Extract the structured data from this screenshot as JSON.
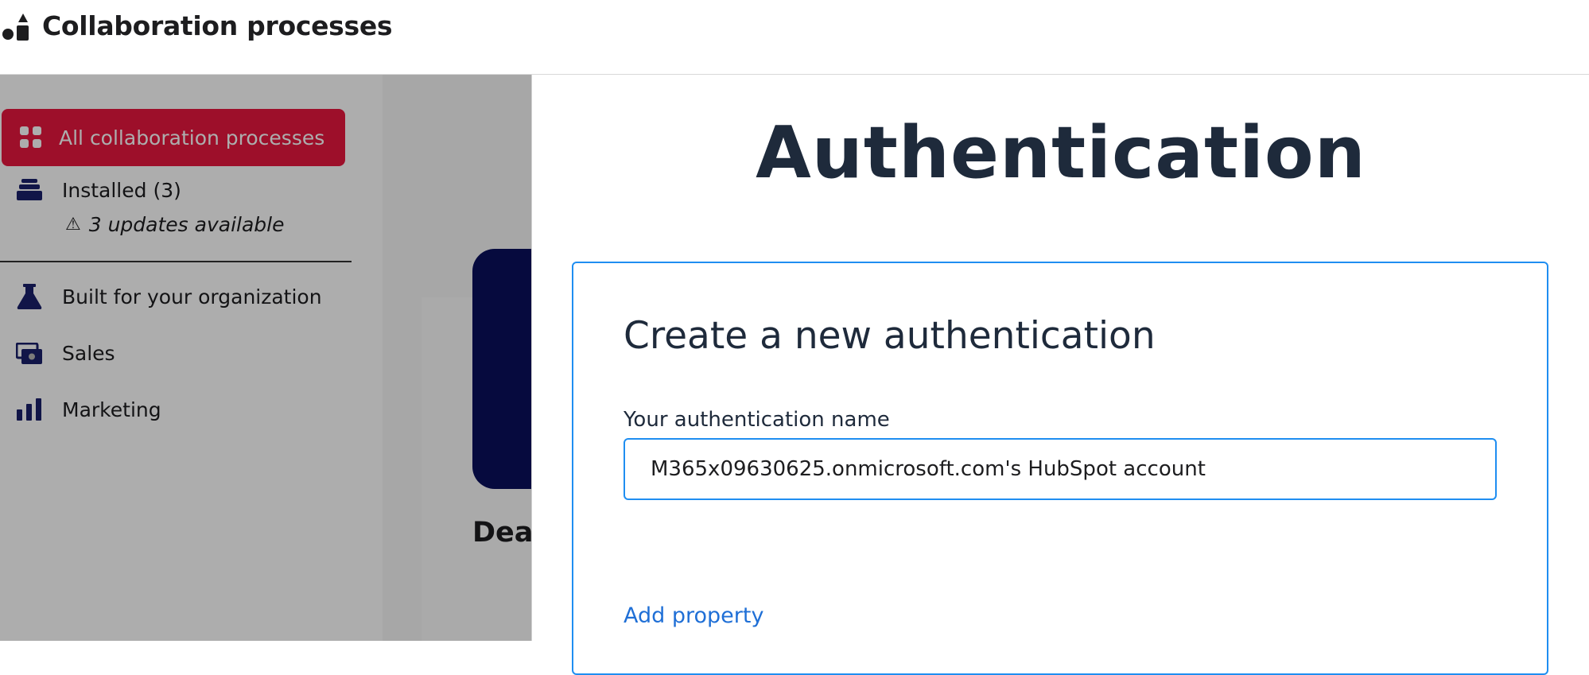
{
  "header": {
    "title": "Collaboration processes",
    "icon": "shapes-icon"
  },
  "sidebar": {
    "active_item": {
      "label": "All collaboration processes",
      "icon": "grid-icon"
    },
    "installed": {
      "label": "Installed (3)",
      "icon": "stack-icon",
      "sub_label": "3 updates available",
      "sub_icon": "warning-icon"
    },
    "items": [
      {
        "label": "Built for your organization",
        "icon": "flask-icon"
      },
      {
        "label": "Sales",
        "icon": "money-icon"
      },
      {
        "label": "Marketing",
        "icon": "bar-chart-icon"
      }
    ]
  },
  "background": {
    "partial_heading": "Dea"
  },
  "modal": {
    "title": "Authentication",
    "card_title": "Create a new authentication",
    "field_label": "Your authentication name",
    "field_value": "M365x09630625.onmicrosoft.com's HubSpot account",
    "add_property_label": "Add property"
  },
  "colors": {
    "accent_red": "#e8173f",
    "focus_blue": "#1f8ef1",
    "link_blue": "#1f6fd6",
    "navy": "#0a0f5c",
    "icon_navy": "#1a1f6b"
  }
}
